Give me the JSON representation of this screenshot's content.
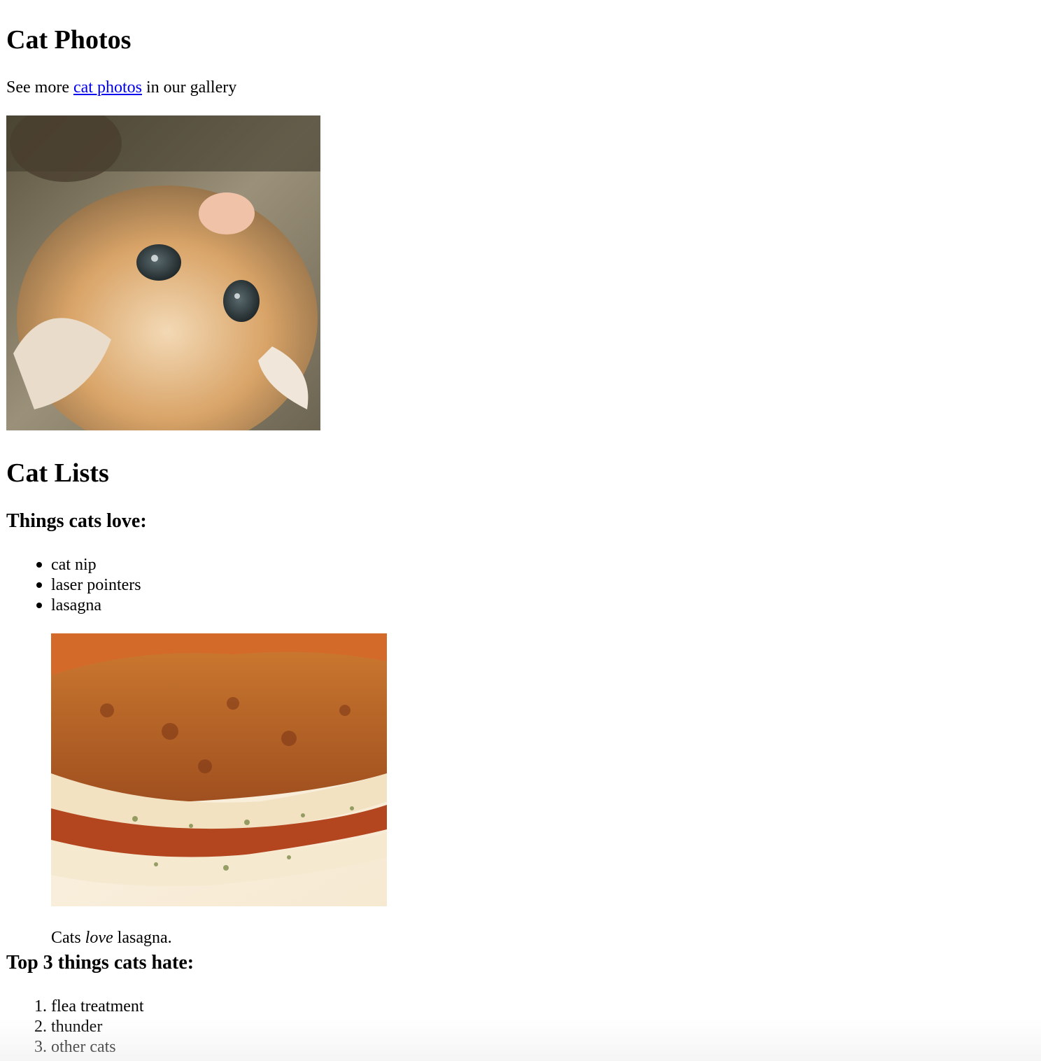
{
  "main": {
    "title": "Cat Photos",
    "intro": {
      "prefix": "See more ",
      "link_text": "cat photos",
      "suffix": " in our gallery"
    },
    "cat_image_alt": "A cute orange cat lying on its back.",
    "lists_heading": "Cat Lists",
    "loves_heading": "Things cats love:",
    "loves": [
      "cat nip",
      "laser pointers",
      "lasagna"
    ],
    "lasagna_image_alt": "A slice of lasagna on a plate.",
    "caption": {
      "prefix": "Cats ",
      "emphasis": "love",
      "suffix": " lasagna."
    },
    "hates_heading": "Top 3 things cats hate:",
    "hates": [
      "flea treatment",
      "thunder",
      "other cats"
    ]
  },
  "colors": {
    "link": "#0000ee",
    "text": "#000000",
    "background": "#ffffff"
  }
}
